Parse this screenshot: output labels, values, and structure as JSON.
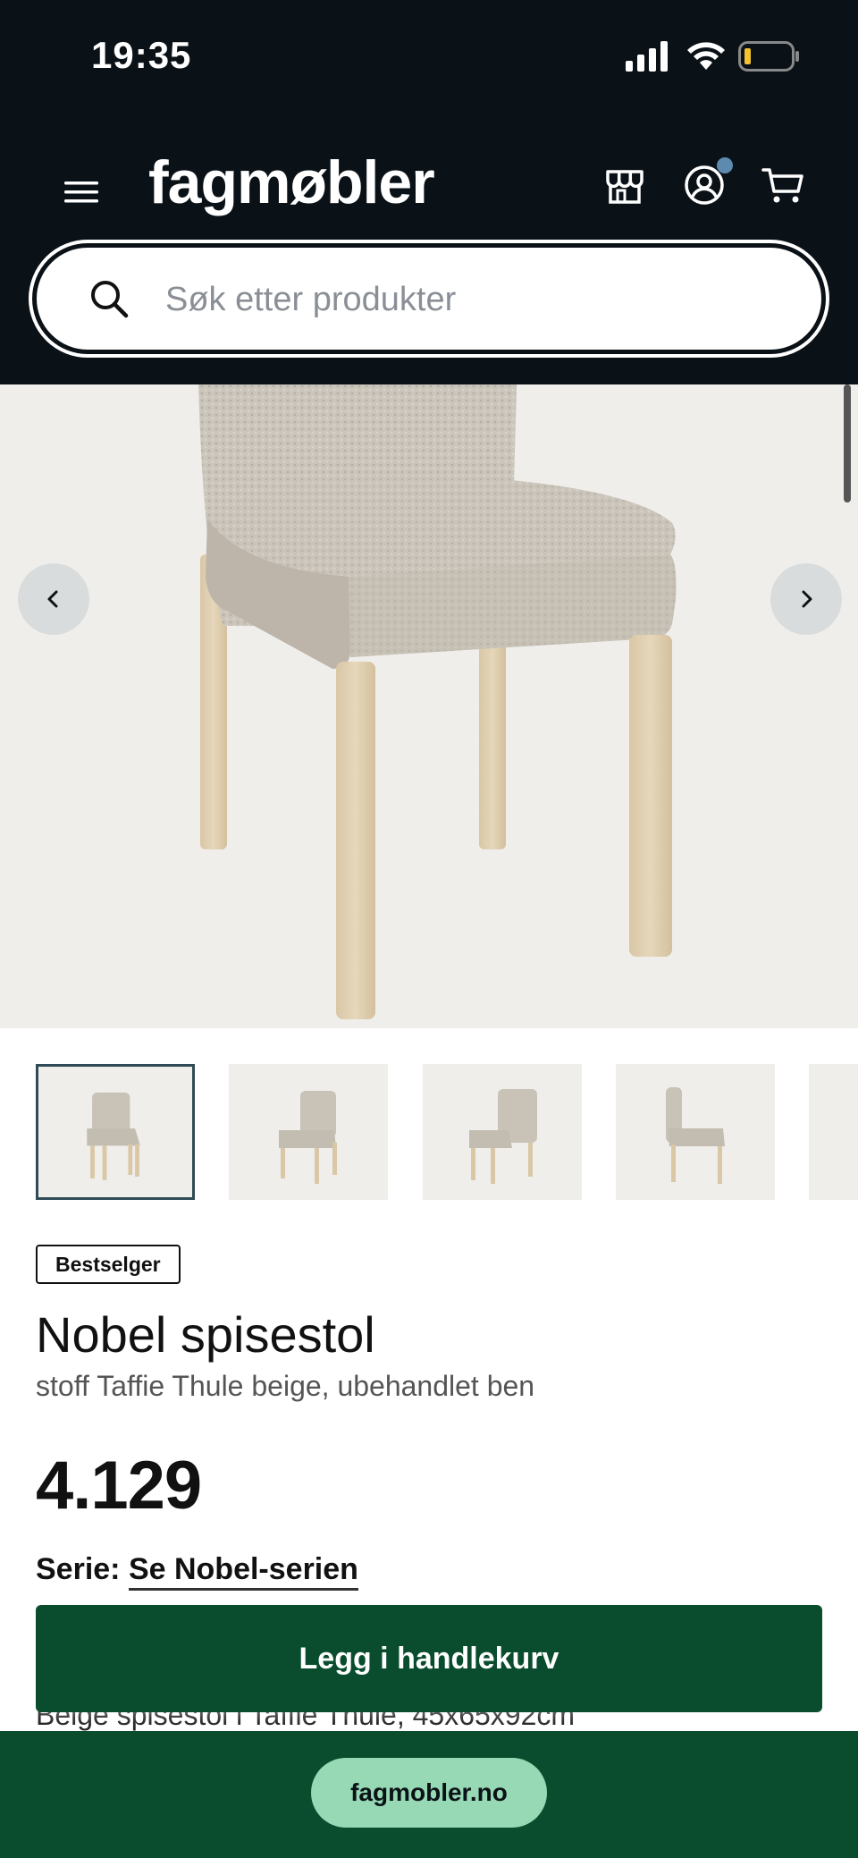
{
  "status_bar": {
    "time": "19:35"
  },
  "header": {
    "logo": "fagmøbler",
    "search": {
      "placeholder": "Søk etter produkter",
      "value": ""
    }
  },
  "product": {
    "badge": "Bestselger",
    "title": "Nobel spisestol",
    "subtitle": "stoff Taffie Thule beige, ubehandlet ben",
    "price": "4.129",
    "series_label": "Serie:",
    "series_link": "Se Nobel-serien",
    "description_preview": "Beige spisestol i Taffie Thule, 45x65x92cm"
  },
  "actions": {
    "add_to_cart": "Legg i handlekurv"
  },
  "browser": {
    "url": "fagmobler.no"
  },
  "colors": {
    "header_bg": "#0b1217",
    "brand_green": "#0a4d2e",
    "url_pill": "#96d9b4",
    "notification_dot": "#5d8bb0",
    "image_bg": "#efeeeb"
  },
  "icons": [
    "menu-icon",
    "store-icon",
    "account-icon",
    "cart-icon",
    "search-icon",
    "chevron-left-icon",
    "chevron-right-icon"
  ]
}
